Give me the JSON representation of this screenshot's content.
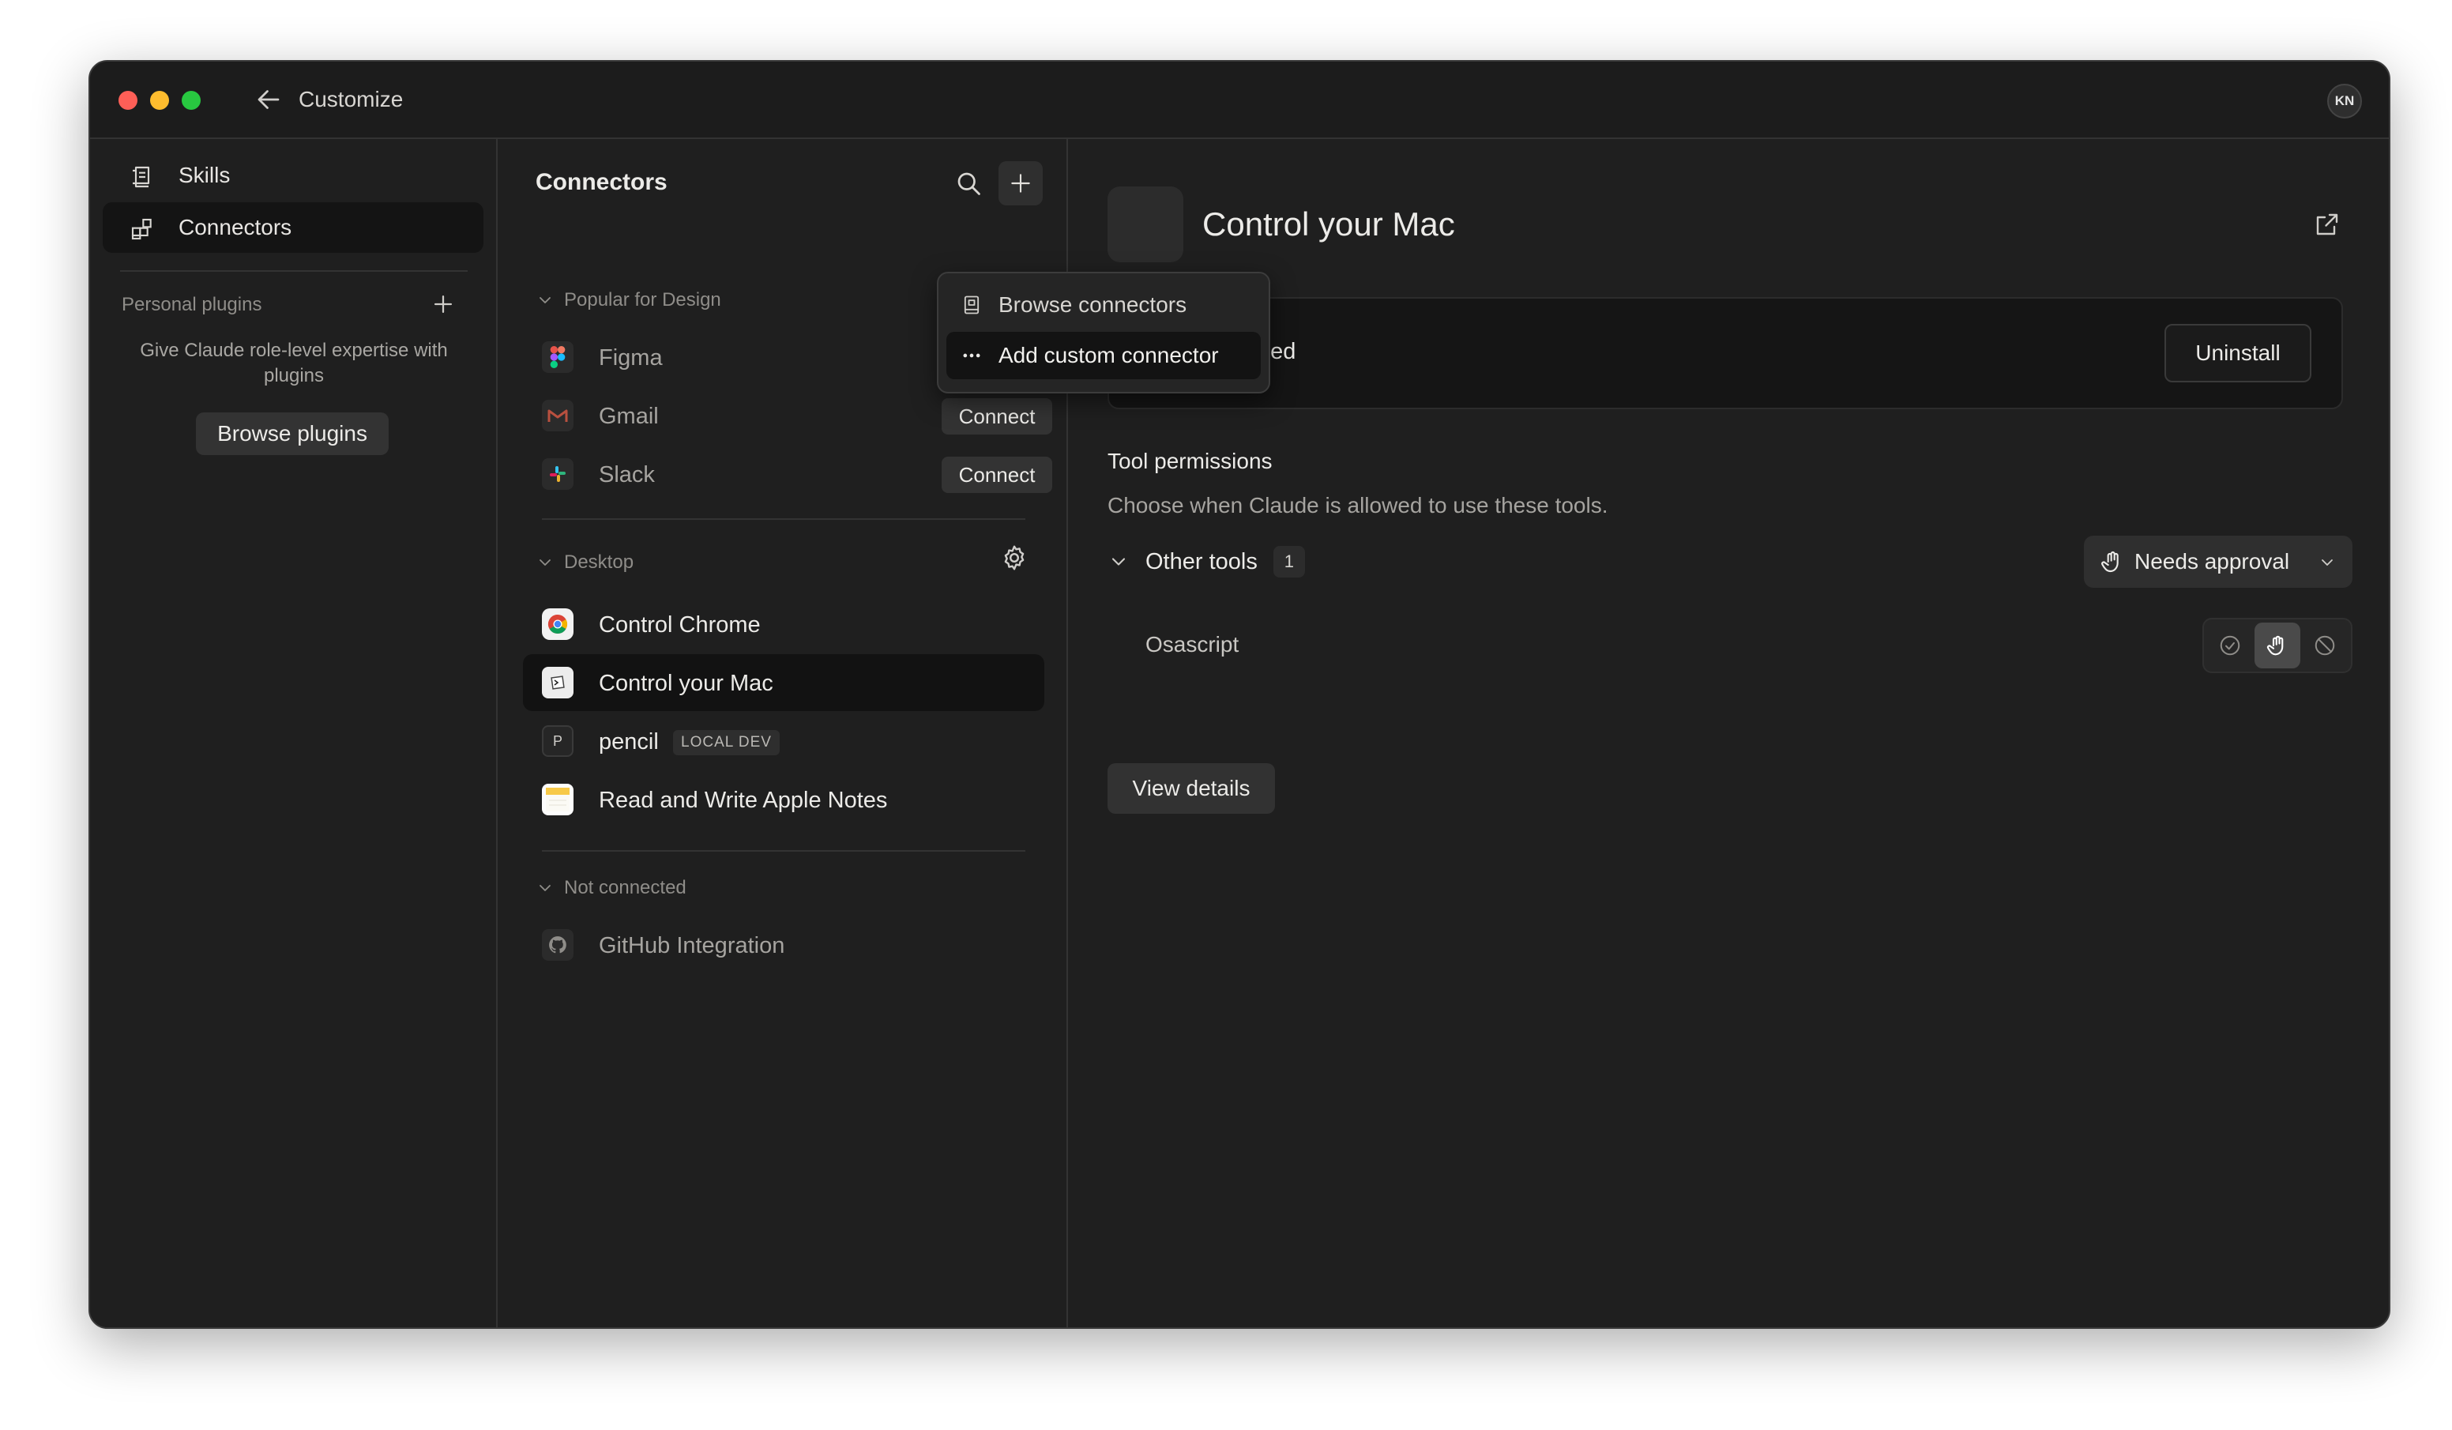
{
  "window": {
    "title": "Customize",
    "avatar_initials": "KN"
  },
  "sidebar": {
    "items": [
      {
        "label": "Skills",
        "icon": "skills-icon",
        "active": false
      },
      {
        "label": "Connectors",
        "icon": "connectors-icon",
        "active": true
      }
    ],
    "personal_plugins": {
      "title": "Personal plugins",
      "description": "Give Claude role-level expertise with plugins",
      "browse_label": "Browse plugins"
    }
  },
  "connectors": {
    "title": "Connectors",
    "sections": [
      {
        "name": "Popular for Design",
        "items": [
          {
            "name": "Figma",
            "icon": "figma-icon",
            "action": ""
          },
          {
            "name": "Gmail",
            "icon": "gmail-icon",
            "action": "Connect"
          },
          {
            "name": "Slack",
            "icon": "slack-icon",
            "action": "Connect"
          }
        ]
      },
      {
        "name": "Desktop",
        "items": [
          {
            "name": "Control Chrome",
            "icon": "chrome-icon"
          },
          {
            "name": "Control your Mac",
            "icon": "mac-icon",
            "selected": true
          },
          {
            "name": "pencil",
            "icon": "pencil-letter-icon",
            "icon_letter": "P",
            "badge": "LOCAL DEV"
          },
          {
            "name": "Read and Write Apple Notes",
            "icon": "notes-icon"
          }
        ]
      },
      {
        "name": "Not connected",
        "items": [
          {
            "name": "GitHub Integration",
            "icon": "github-icon"
          }
        ]
      }
    ]
  },
  "add_menu": {
    "items": [
      {
        "label": "Browse connectors",
        "icon": "book-icon"
      },
      {
        "label": "Add custom connector",
        "icon": "more-dots-icon"
      }
    ]
  },
  "detail": {
    "title": "Control your Mac",
    "enabled_label": "Enabled",
    "enabled": true,
    "uninstall_label": "Uninstall",
    "tool_permissions": {
      "title": "Tool permissions",
      "description": "Choose when Claude is allowed to use these tools.",
      "group_label": "Other tools",
      "group_count": "1",
      "group_setting": "Needs approval",
      "tools": [
        {
          "name": "Osascript",
          "setting": "needs-approval"
        }
      ]
    },
    "view_details_label": "View details"
  },
  "colors": {
    "toggle_on": "#5e8fdc",
    "traffic_red": "#fe5f57",
    "traffic_yellow": "#febc2e",
    "traffic_green": "#28c840"
  }
}
